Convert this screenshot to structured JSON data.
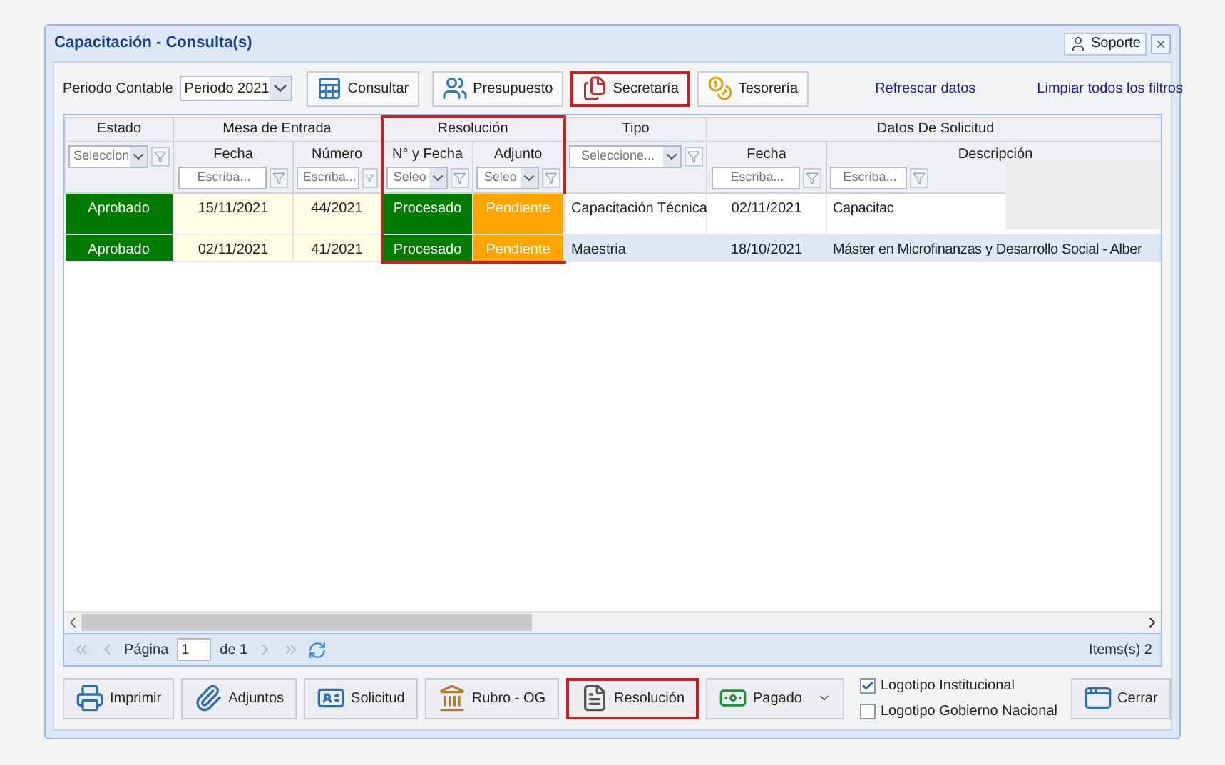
{
  "window": {
    "title": "Capacitación - Consulta(s)",
    "support_button": "Soporte",
    "close_button": "×"
  },
  "toolbar": {
    "period_label": "Periodo Contable",
    "period_value": "Periodo 2021",
    "buttons": [
      {
        "label": "Consultar",
        "kind": "table",
        "highlighted": false
      },
      {
        "label": "Presupuesto",
        "kind": "people",
        "highlighted": false
      },
      {
        "label": "Secretaría",
        "kind": "files",
        "highlighted": true
      },
      {
        "label": "Tesorería",
        "kind": "coins",
        "highlighted": false
      }
    ],
    "links": [
      "Refrescar datos",
      "Limpiar todos los filtros"
    ]
  },
  "grid": {
    "groups": [
      {
        "label": "Estado",
        "highlighted": false,
        "columns": [
          {
            "filter": {
              "kind": "select",
              "placeholder": "Seleccion"
            }
          }
        ]
      },
      {
        "label": "Mesa de Entrada",
        "highlighted": false,
        "columns": [
          {
            "label": "Fecha",
            "filter": {
              "kind": "text",
              "placeholder": "Escriba..."
            }
          },
          {
            "label": "Número",
            "filter": {
              "kind": "text",
              "placeholder": "Escriba..."
            }
          }
        ]
      },
      {
        "label": "Resolución",
        "highlighted": true,
        "columns": [
          {
            "label": "N° y Fecha",
            "filter": {
              "kind": "select",
              "placeholder": "Seleo"
            }
          },
          {
            "label": "Adjunto",
            "filter": {
              "kind": "select",
              "placeholder": "Seleo"
            }
          }
        ]
      },
      {
        "label": "Tipo",
        "highlighted": false,
        "columns": [
          {
            "filter": {
              "kind": "select",
              "placeholder": "Seleccione..."
            }
          }
        ]
      },
      {
        "label": "Datos De Solicitud",
        "highlighted": false,
        "columns": [
          {
            "label": "Fecha",
            "filter": {
              "kind": "text",
              "placeholder": "Escriba..."
            }
          },
          {
            "label": "Descripción",
            "filter": {
              "kind": "text",
              "placeholder": "Escriba..."
            }
          }
        ]
      }
    ],
    "rows": [
      {
        "selected": false,
        "cells": [
          {
            "text": "Aprobado",
            "color": "#007a00"
          },
          {
            "text": "15/11/2021",
            "color": "#fffde6"
          },
          {
            "text": "44/2021",
            "color": "#fffde6"
          },
          {
            "text": "Procesado",
            "color": "#007a00"
          },
          {
            "text": "Pendiente",
            "color": "#ffa500"
          },
          {
            "text": "Capacitación Técnica"
          },
          {
            "text": "02/11/2021"
          },
          {
            "text": "Capacitac"
          }
        ]
      },
      {
        "selected": true,
        "cells": [
          {
            "text": "Aprobado",
            "color": "#007a00"
          },
          {
            "text": "02/11/2021",
            "color": "#fffde6"
          },
          {
            "text": "41/2021",
            "color": "#fffde6"
          },
          {
            "text": "Procesado",
            "color": "#007a00"
          },
          {
            "text": "Pendiente",
            "color": "#ffa500"
          },
          {
            "text": "Maestria"
          },
          {
            "text": "18/10/2021"
          },
          {
            "text": "Máster en Microfinanzas y Desarrollo Social - Alber"
          }
        ]
      }
    ],
    "redacted": true,
    "pager": {
      "page_label": "Página",
      "page_value": "1",
      "of_label": "de 1",
      "items": "Items(s) 2"
    }
  },
  "bottom_bar": {
    "buttons": [
      {
        "label": "Imprimir",
        "kind": "printer",
        "highlighted": false
      },
      {
        "label": "Adjuntos",
        "kind": "attach",
        "highlighted": false
      },
      {
        "label": "Solicitud",
        "kind": "card",
        "highlighted": false
      },
      {
        "label": "Rubro - OG",
        "kind": "bank",
        "highlighted": false
      },
      {
        "label": "Resolución",
        "kind": "document",
        "highlighted": true
      },
      {
        "label": "Pagado",
        "kind": "money",
        "highlighted": false
      }
    ],
    "checkboxes": [
      {
        "label": "Logotipo Institucional",
        "checked": true
      },
      {
        "label": "Logotipo Gobierno Nacional",
        "checked": false
      }
    ],
    "close_button": "Cerrar"
  }
}
